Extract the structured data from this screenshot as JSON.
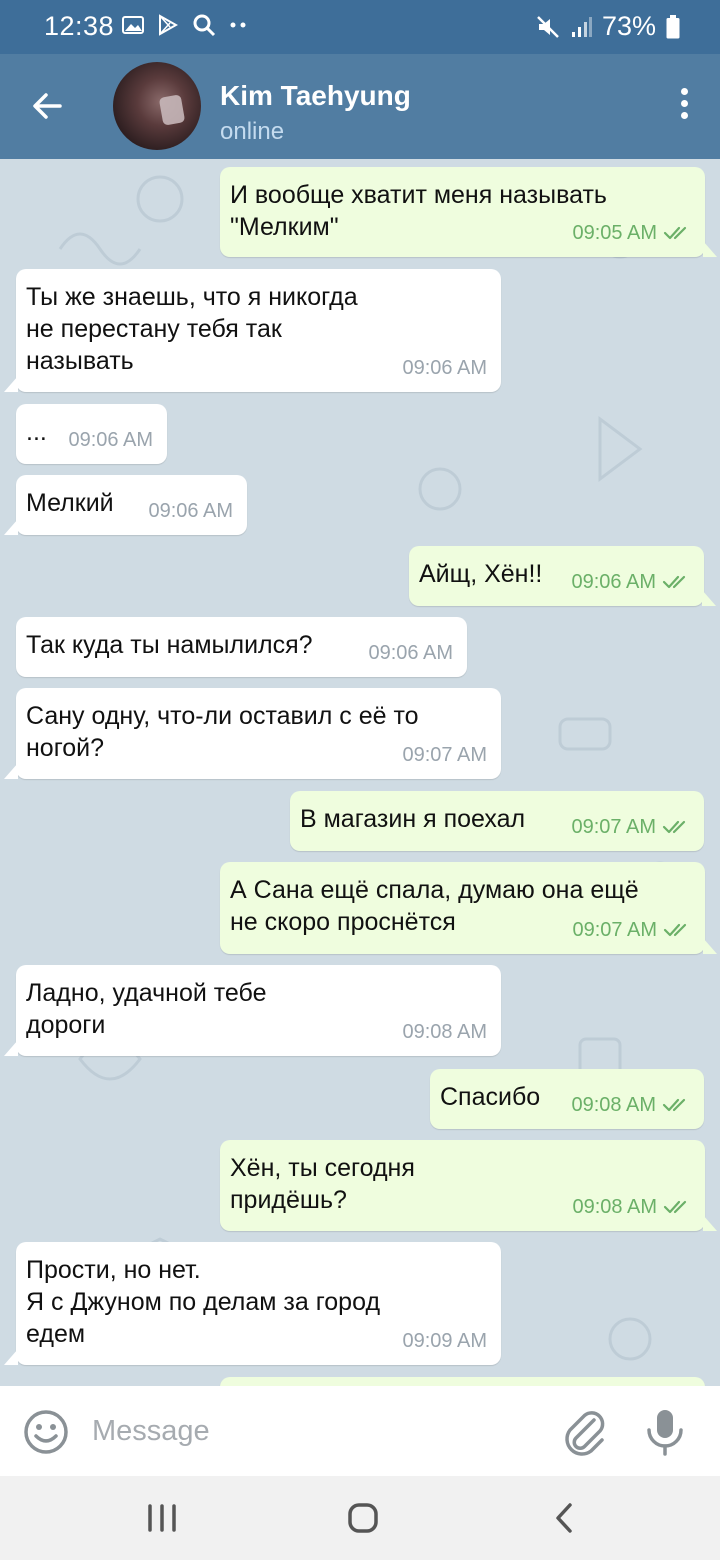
{
  "status_bar": {
    "time": "12:38",
    "battery": "73%"
  },
  "header": {
    "back_icon": "arrow-left-icon",
    "contact_name": "Kim Taehyung",
    "contact_status": "online",
    "menu_icon": "more-vertical-icon"
  },
  "messages": [
    {
      "side": "out",
      "text": "И вообще хватит меня называть\n\"Мелким\"",
      "time": "09:05 AM",
      "read": true
    },
    {
      "side": "in",
      "text": "Ты же знаешь, что я никогда\nне перестану тебя так\nназывать",
      "time": "09:06 AM"
    },
    {
      "side": "in",
      "text": "...",
      "time": "09:06 AM"
    },
    {
      "side": "in",
      "text": "Мелкий",
      "time": "09:06 AM"
    },
    {
      "side": "out",
      "text": "Айщ, Хён!!",
      "time": "09:06 AM",
      "read": true
    },
    {
      "side": "in",
      "text": "Так куда ты намылился?",
      "time": "09:06 AM"
    },
    {
      "side": "in",
      "text": "Сану одну, что-ли оставил с её то\nногой?",
      "time": "09:07 AM"
    },
    {
      "side": "out",
      "text": "В магазин я поехал",
      "time": "09:07 AM",
      "read": true
    },
    {
      "side": "out",
      "text": "А Сана ещё спала, думаю она ещё\nне скоро проснётся",
      "time": "09:07 AM",
      "read": true
    },
    {
      "side": "in",
      "text": "Ладно, удачной тебе\nдороги",
      "time": "09:08 AM"
    },
    {
      "side": "out",
      "text": "Спасибо",
      "time": "09:08 AM",
      "read": true
    },
    {
      "side": "out",
      "text": "Хён, ты сегодня\nпридёшь?",
      "time": "09:08 AM",
      "read": true
    },
    {
      "side": "in",
      "text": "Прости, но нет.\nЯ с Джуном по делам за город\nедем",
      "time": "09:09 AM"
    }
  ],
  "input": {
    "placeholder": "Message",
    "value": ""
  },
  "colors": {
    "header": "#517da2",
    "status_bar": "#3e6e99",
    "outgoing_bubble": "#effdde",
    "incoming_bubble": "#ffffff",
    "read_check": "#6bb068"
  }
}
